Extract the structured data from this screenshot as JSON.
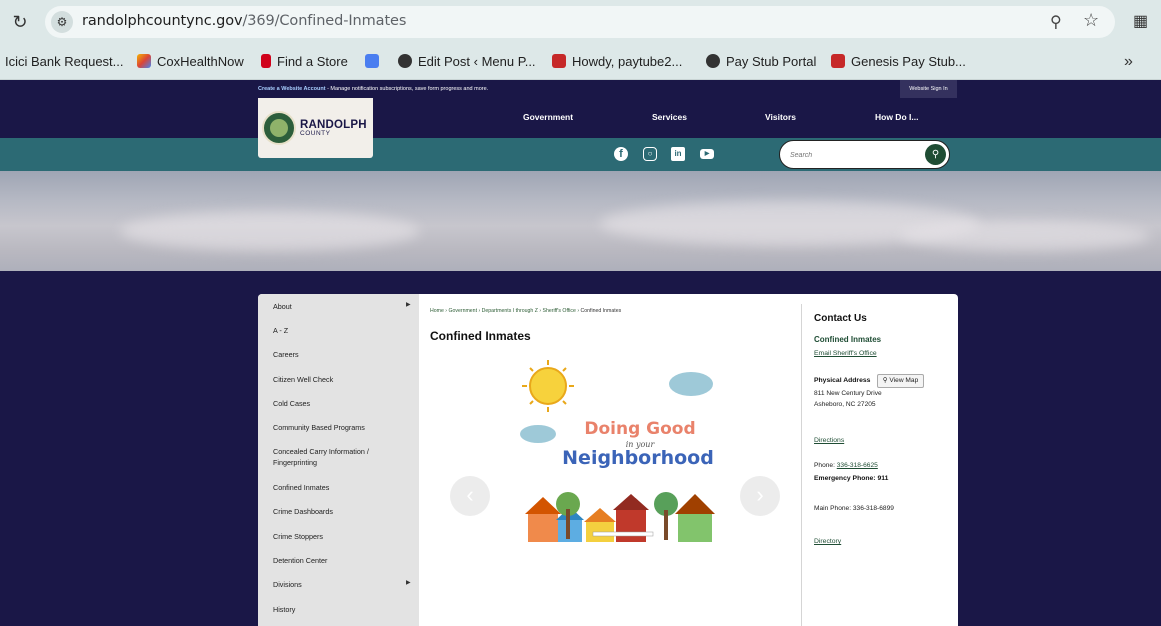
{
  "browser": {
    "url_domain": "randolphcountync.gov",
    "url_path": "/369/Confined-Inmates",
    "bookmarks": [
      {
        "label": "Icici Bank Request...",
        "color": ""
      },
      {
        "label": "CoxHealthNow",
        "color": "#5b8def"
      },
      {
        "label": "Find a Store",
        "color": "#d0021b"
      },
      {
        "label": "",
        "color": "#4a7ef0"
      },
      {
        "label": "Edit Post ‹ Menu P...",
        "color": "#333333"
      },
      {
        "label": "Howdy, paytube2...",
        "color": "#c62828"
      },
      {
        "label": "Pay Stub Portal",
        "color": "#333333"
      },
      {
        "label": "Genesis Pay Stub...",
        "color": "#c62828"
      }
    ],
    "more_bookmarks": "»"
  },
  "site": {
    "create_account": "Create a Website Account",
    "create_account_rest": " - Manage notification subscriptions, save form progress and more.",
    "sign_in": "Website Sign In",
    "logo_name": "RANDOLPH",
    "logo_sub": "COUNTY",
    "nav": [
      "Government",
      "Services",
      "Visitors",
      "How Do I..."
    ],
    "social": [
      "facebook",
      "instagram",
      "linkedin",
      "youtube"
    ],
    "search_placeholder": "Search"
  },
  "sidebar": {
    "items": [
      {
        "label": "About",
        "has_sub": true
      },
      {
        "label": "A - Z",
        "has_sub": false
      },
      {
        "label": "Careers",
        "has_sub": false
      },
      {
        "label": "Citizen Well Check",
        "has_sub": false
      },
      {
        "label": "Cold Cases",
        "has_sub": false
      },
      {
        "label": "Community Based Programs",
        "has_sub": false
      },
      {
        "label": "Concealed Carry Information / Fingerprinting",
        "has_sub": false
      },
      {
        "label": "Confined Inmates",
        "has_sub": false
      },
      {
        "label": "Crime Dashboards",
        "has_sub": false
      },
      {
        "label": "Crime Stoppers",
        "has_sub": false
      },
      {
        "label": "Detention Center",
        "has_sub": false
      },
      {
        "label": "Divisions",
        "has_sub": true
      },
      {
        "label": "History",
        "has_sub": false
      }
    ]
  },
  "main": {
    "breadcrumb": [
      "Home",
      "Government",
      "Departments I through Z",
      "Sheriff's Office"
    ],
    "breadcrumb_current": "Confined Inmates",
    "title": "Confined Inmates",
    "slide_line1": "Doing Good",
    "slide_line2": "in your",
    "slide_line3": "Neighborhood"
  },
  "contact": {
    "heading": "Contact Us",
    "department": "Confined Inmates",
    "email_link": "Email Sheriff's Office",
    "physical_address_label": "Physical Address",
    "view_map": "View Map",
    "address_line1": "811 New Century Drive",
    "address_line2": "Asheboro, NC 27205",
    "directions": "Directions",
    "phone_label": "Phone: ",
    "phone": "336-318-6625",
    "emergency": "Emergency Phone: 911",
    "main_phone": "Main Phone: 336-318-6899",
    "directory": "Directory"
  }
}
